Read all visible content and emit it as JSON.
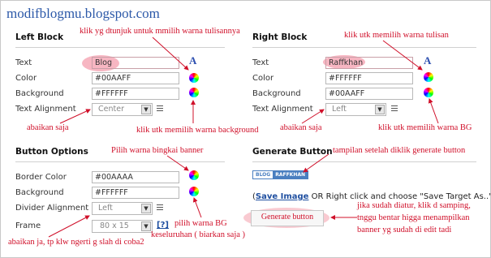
{
  "site_title": "modifblogmu.blogspot.com",
  "left_block": {
    "title": "Left Block",
    "text_label": "Text",
    "text_value": "Blog",
    "color_label": "Color",
    "color_value": "#00AAFF",
    "background_label": "Background",
    "background_value": "#FFFFFF",
    "alignment_label": "Text Alignment",
    "alignment_value": "Center"
  },
  "right_block": {
    "title": "Right Block",
    "text_label": "Text",
    "text_value": "Raffkhan",
    "color_label": "Color",
    "color_value": "#FFFFFF",
    "background_label": "Background",
    "background_value": "#00AAFF",
    "alignment_label": "Text Alignment",
    "alignment_value": "Left"
  },
  "button_options": {
    "title": "Button Options",
    "border_label": "Border Color",
    "border_value": "#00AAAA",
    "background_label": "Background",
    "background_value": "#FFFFFF",
    "divider_label": "Divider Alignment",
    "divider_value": "Left",
    "frame_label": "Frame",
    "frame_value": "80 x 15",
    "help_label": "[?]"
  },
  "generate": {
    "title": "Generate Button",
    "badge_left": "BLOG",
    "badge_right": "RAFFKHAN",
    "save_open": "(",
    "save_link": "Save Image",
    "save_rest": " OR Right click and choose \"Save Target As..\")",
    "button_label": "Generate button"
  },
  "notes": {
    "n1": "klik yg dtunjuk untuk mmilih warna tulisannya",
    "n2": "klik utk memilih warna tulisan",
    "n3": "abaikan saja",
    "n4": "klik utk memilih warna background",
    "n5": "abaikan saja",
    "n6": "klik utk memilih warna BG",
    "n7": "Pilih warna bingkai banner",
    "n8": "tampilan setelah diklik generate button",
    "n9": "pilih warna BG",
    "n10": "keseluruhan ( biarkan saja )",
    "n11": "abaikan ja, tp klw ngerti g slah di coba2",
    "n12": "jika sudah diatur, klik d samping,",
    "n13": "tnggu bentar higga menampilkan",
    "n14": "banner yg sudah di edit tadi"
  },
  "colors": {
    "accent": "#d0102a",
    "link": "#1f4fa0",
    "title": "#2b58a8",
    "badge": "#4a7fc0"
  }
}
